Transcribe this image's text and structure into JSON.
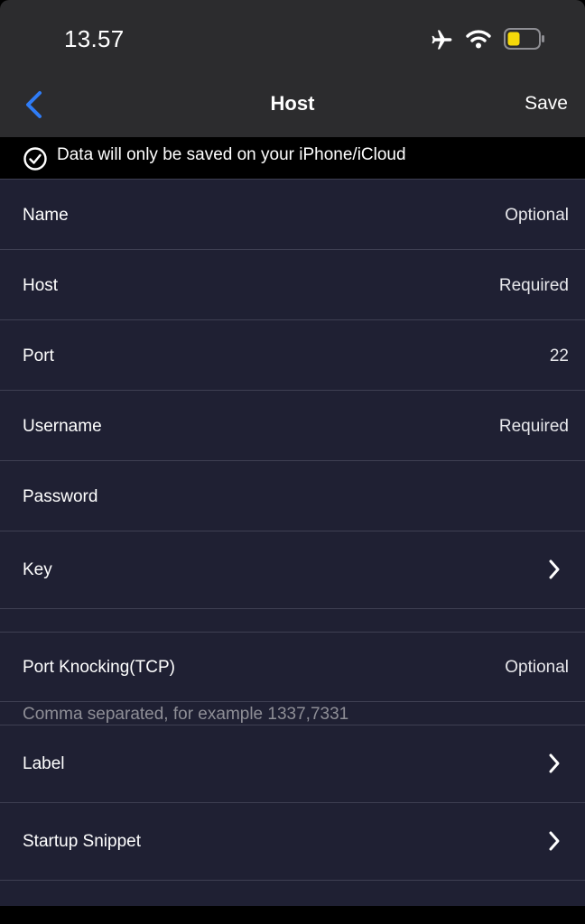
{
  "status_bar": {
    "time": "13.57",
    "icons": [
      "airplane-icon",
      "wifi-icon",
      "battery-low-icon"
    ],
    "battery_color": "#f5d90a"
  },
  "nav": {
    "title": "Host",
    "save_label": "Save",
    "back_icon": "chevron-left-icon",
    "accent_color": "#2f7cf6"
  },
  "notice": {
    "text": "Data will only be saved on your iPhone/iCloud",
    "icon": "checkmark-circle-icon"
  },
  "form": {
    "name": {
      "label": "Name",
      "placeholder": "Optional"
    },
    "host": {
      "label": "Host",
      "placeholder": "Required"
    },
    "port": {
      "label": "Port",
      "value": "22"
    },
    "username": {
      "label": "Username",
      "placeholder": "Required"
    },
    "password": {
      "label": "Password"
    },
    "key": {
      "label": "Key"
    },
    "port_knocking": {
      "label": "Port Knocking(TCP)",
      "placeholder": "Optional",
      "hint": "Comma separated, for example 1337,7331"
    },
    "label_row": {
      "label": "Label"
    },
    "startup_snippet": {
      "label": "Startup Snippet"
    }
  }
}
